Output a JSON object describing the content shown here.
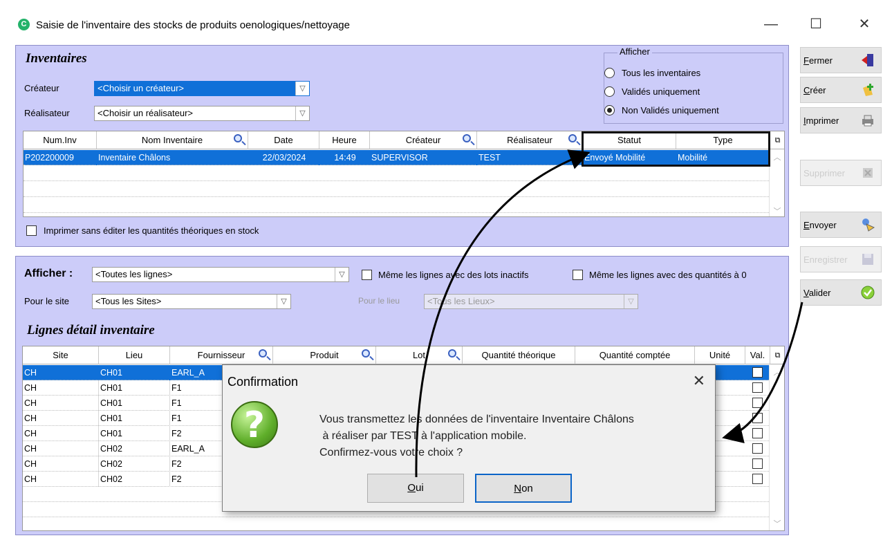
{
  "window": {
    "title": "Saisie de l'inventaire des stocks de produits oenologiques/nettoyage",
    "icon_letter": "C",
    "minimize": "—",
    "maximize": "☐",
    "close": "✕"
  },
  "inventaires": {
    "title": "Inventaires",
    "createur_label": "Créateur",
    "createur_value": "<Choisir un créateur>",
    "realisateur_label": "Réalisateur",
    "realisateur_value": "<Choisir un réalisateur>",
    "afficher": {
      "title": "Afficher",
      "options": [
        "Tous les inventaires",
        "Validés uniquement",
        "Non Validés uniquement"
      ],
      "selected_index": 2
    },
    "columns": [
      "Num.Inv",
      "Nom Inventaire",
      "Date",
      "Heure",
      "Créateur",
      "Réalisateur",
      "Statut",
      "Type"
    ],
    "rows": [
      [
        "P202200009",
        "Inventaire Châlons",
        "22/03/2024",
        "14:49",
        "SUPERVISOR",
        "TEST",
        "Envoyé Mobilité",
        "Mobilité"
      ]
    ],
    "print_checkbox_label": "Imprimer sans éditer les quantités théoriques en stock"
  },
  "details": {
    "afficher_label": "Afficher :",
    "afficher_value": "<Toutes les lignes>",
    "chk_lots_label": "Même les lignes avec des lots inactifs",
    "chk_qte_label": "Même les lignes avec des quantités à 0",
    "site_label": "Pour le site",
    "site_value": "<Tous les Sites>",
    "lieu_label": "Pour le lieu",
    "lieu_value": "<Tous les Lieux>",
    "title": "Lignes détail inventaire",
    "columns": [
      "Site",
      "Lieu",
      "Fournisseur",
      "Produit",
      "Lot",
      "Quantité théorique",
      "Quantité comptée",
      "Unité",
      "Val."
    ],
    "rows": [
      [
        "CH",
        "CH01",
        "EARL_A"
      ],
      [
        "CH",
        "CH01",
        "F1"
      ],
      [
        "CH",
        "CH01",
        "F1"
      ],
      [
        "CH",
        "CH01",
        "F1"
      ],
      [
        "CH",
        "CH01",
        "F2"
      ],
      [
        "CH",
        "CH02",
        "EARL_A"
      ],
      [
        "CH",
        "CH02",
        "F2"
      ],
      [
        "CH",
        "CH02",
        "F2"
      ]
    ]
  },
  "sidebar": {
    "fermer": {
      "u": "F",
      "rest": "ermer"
    },
    "creer": {
      "u": "C",
      "rest": "réer"
    },
    "imprimer": {
      "u": "I",
      "rest": "mprimer"
    },
    "supprimer": {
      "u": "",
      "rest": "Supprimer"
    },
    "envoyer": {
      "u": "E",
      "rest": "nvoyer"
    },
    "enregistrer": {
      "u": "",
      "rest": "Enregistrer"
    },
    "valider": {
      "u": "V",
      "rest": "alider"
    }
  },
  "dialog": {
    "title": "Confirmation",
    "close": "✕",
    "icon_glyph": "?",
    "lines": [
      "Vous transmettez les données de l'inventaire Inventaire Châlons",
      " à réaliser par TEST à l'application mobile.",
      "Confirmez-vous votre choix ?"
    ],
    "oui": {
      "u": "O",
      "rest": "ui"
    },
    "non": {
      "u": "N",
      "rest": "on"
    }
  },
  "colors": {
    "panel": "#ccccf9",
    "selection": "#1070d8",
    "highlight": "#111111"
  }
}
